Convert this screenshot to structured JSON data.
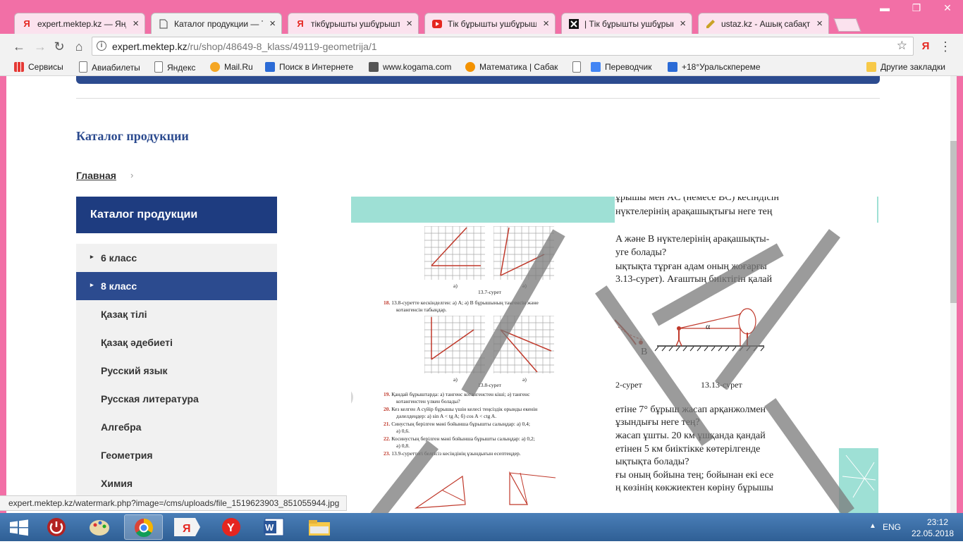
{
  "browser": {
    "tabs": [
      {
        "label": "expert.mektep.kz — Янде",
        "favicon": "yandex-icon",
        "color": "#e52620"
      },
      {
        "label": "Каталог продукции — Тi",
        "favicon": "page-icon",
        "color": "#666666"
      },
      {
        "label": "тiкбұрышты ушбұрышты",
        "favicon": "yandex-icon",
        "color": "#e52620"
      },
      {
        "label": "Тiк бұрышты ушбұрыште",
        "favicon": "play-icon",
        "color": "#e52620"
      },
      {
        "label": "| Тiк бұрышты ушбұрыш",
        "favicon": "x-icon",
        "color": "#111111"
      },
      {
        "label": "ustaz.kz - Ашық сабақта",
        "favicon": "pencil-icon",
        "color": "#c9a227"
      }
    ],
    "url_host": "expert.mektep.kz",
    "url_path": "/ru/shop/48649-8_klass/49119-geometrija/1",
    "bookmarks": [
      {
        "label": "Сервисы",
        "icon": "apps-icon"
      },
      {
        "label": "Авиабилеты",
        "icon": "page-icon"
      },
      {
        "label": "Яндекс",
        "icon": "page-icon"
      },
      {
        "label": "Mail.Ru",
        "icon": "mailru-icon"
      },
      {
        "label": "Поиск в Интернете",
        "icon": "search-icon"
      },
      {
        "label": "www.kogama.com",
        "icon": "kogama-icon"
      },
      {
        "label": "Математика | Сабак",
        "icon": "info-icon"
      },
      {
        "label": "",
        "icon": "page-icon"
      },
      {
        "label": "Переводчик",
        "icon": "translate-icon"
      },
      {
        "label": "+18°Уральскпереме",
        "icon": "search-icon"
      },
      {
        "label": "Другие закладки",
        "icon": "folder-icon"
      }
    ],
    "status_url": "expert.mektep.kz/watermark.php?image=/cms/uploads/file_1519623903_851055944.jpg"
  },
  "page": {
    "title": "Каталог продукции",
    "breadcrumb": "Главная",
    "sidebar_title": "Каталог продукции",
    "sidebar_items": [
      {
        "label": "6 класс",
        "caret": true,
        "active": false
      },
      {
        "label": "8 класс",
        "caret": true,
        "active": true
      },
      {
        "label": "Қазақ тілі",
        "caret": false,
        "active": false
      },
      {
        "label": "Қазақ әдебиеті",
        "caret": false,
        "active": false
      },
      {
        "label": "Русский язык",
        "caret": false,
        "active": false
      },
      {
        "label": "Русская литература",
        "caret": false,
        "active": false
      },
      {
        "label": "Алгебра",
        "caret": false,
        "active": false
      },
      {
        "label": "Геометрия",
        "caret": false,
        "active": false
      },
      {
        "label": "Химия",
        "caret": false,
        "active": false
      }
    ]
  },
  "scan": {
    "right_lines": [
      "ұрышы мен AC (немесе BC) кесіндісін",
      "нүктелерінің арақашықтығы неге тең",
      "A және B нүктелерінің арақашықты-",
      "уге болады?",
      "ықтықта тұрған адам оның жоғарғы",
      "3.13-сурет). Ағаштың биіктігін қалай",
      "етіне 7° бұрыш жасап арқанжолмен",
      "ұзындығы неге тең?",
      "жасап ұшты. 20 км ұшқанда қандай",
      "етінен 5 км биіктікке көтерілгенде",
      "ықтықта болады?",
      "ғы оның бойына тең; бойынан екі есе",
      "ң көзінің көкжиектен көріну бұрышы"
    ],
    "fig_caption_left": "2-сурет",
    "fig_caption_right": "13.13-сурет",
    "label_B": "B",
    "label_alpha": "α",
    "left_texts": {
      "cap1": "13.7-сурет",
      "a1": "а)",
      "b1": "ә)",
      "p18_num": "18.",
      "p18a": "13.8-суретте кескінделген: а) A; ә) B бұрышының тангенсін және",
      "p18b": "котангенсін табыңдар.",
      "cap2": "13.8-сурет",
      "a2": "а)",
      "b2": "ә)",
      "p19_num": "19.",
      "p19a": "Қандай бұрыштарда: а) тангенс котангенстен кіші; ә) тангенс",
      "p19b": "котангенстен үлкен болады?",
      "p20_num": "20.",
      "p20a": "Кез келген A сүйір бұрышы үшін келесі теңсіздік орынды екенін",
      "p20b": "дәлелдеңдер: а) sin A < tg A; б) cos A < ctg A.",
      "p21_num": "21.",
      "p21a": "Синустың берілген мәні бойынша бұрышты салыңдар: а) 0,4;",
      "p21b": "ә) 0,6.",
      "p22_num": "22.",
      "p22a": "Косинустың берілген мәні бойынша бұрышты салыңдар: а) 0,2;",
      "p22b": "ә) 0,8.",
      "p23_num": "23.",
      "p23a": "13.9-суреттегі белгісіз кесіндінің ұзындығын есептеңдер."
    }
  },
  "taskbar": {
    "lang": "ENG",
    "time": "23:12",
    "date": "22.05.2018"
  },
  "colors": {
    "chrome_accent": "#f26fa6",
    "site_blue": "#2c4b8f",
    "teal": "#9ee0d5",
    "red_line": "#c0392b"
  }
}
